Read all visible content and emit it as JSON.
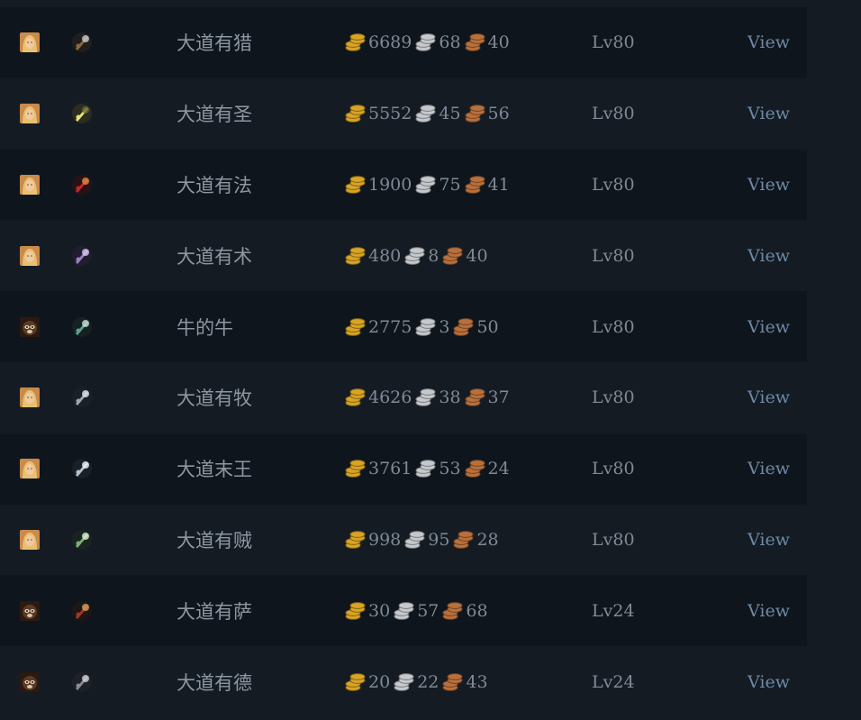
{
  "colors": {
    "gold": "#d8a424",
    "silver": "#c5c8cc",
    "copper": "#b9703c",
    "link": "#6f89a4",
    "text": "#7f8a96",
    "name": "#8d97a2"
  },
  "rows": [
    {
      "race_icon": "human-female-portrait-icon",
      "class_icon": "hunter-icon",
      "name": "大道有猎",
      "gold": "6689",
      "silver": "68",
      "copper": "40",
      "level": "Lv80",
      "action": "View"
    },
    {
      "race_icon": "human-female-portrait-icon",
      "class_icon": "paladin-icon",
      "name": "大道有圣",
      "gold": "5552",
      "silver": "45",
      "copper": "56",
      "level": "Lv80",
      "action": "View"
    },
    {
      "race_icon": "human-female-portrait-icon",
      "class_icon": "mage-icon",
      "name": "大道有法",
      "gold": "1900",
      "silver": "75",
      "copper": "41",
      "level": "Lv80",
      "action": "View"
    },
    {
      "race_icon": "human-female-portrait-icon",
      "class_icon": "warlock-icon",
      "name": "大道有术",
      "gold": "480",
      "silver": "8",
      "copper": "40",
      "level": "Lv80",
      "action": "View"
    },
    {
      "race_icon": "pandaren-portrait-icon",
      "class_icon": "warrior-icon",
      "name": "牛的牛",
      "gold": "2775",
      "silver": "3",
      "copper": "50",
      "level": "Lv80",
      "action": "View"
    },
    {
      "race_icon": "human-female-portrait-icon",
      "class_icon": "priest-icon",
      "name": "大道有牧",
      "gold": "4626",
      "silver": "38",
      "copper": "37",
      "level": "Lv80",
      "action": "View"
    },
    {
      "race_icon": "human-female-portrait-icon",
      "class_icon": "death-knight-icon",
      "name": "大道末王",
      "gold": "3761",
      "silver": "53",
      "copper": "24",
      "level": "Lv80",
      "action": "View"
    },
    {
      "race_icon": "human-female-portrait-icon",
      "class_icon": "rogue-icon",
      "name": "大道有贼",
      "gold": "998",
      "silver": "95",
      "copper": "28",
      "level": "Lv80",
      "action": "View"
    },
    {
      "race_icon": "pandaren-portrait-icon",
      "class_icon": "shaman-icon",
      "name": "大道有萨",
      "gold": "30",
      "silver": "57",
      "copper": "68",
      "level": "Lv24",
      "action": "View"
    },
    {
      "race_icon": "pandaren-portrait-icon",
      "class_icon": "druid-icon",
      "name": "大道有德",
      "gold": "20",
      "silver": "22",
      "copper": "43",
      "level": "Lv24",
      "action": "View"
    }
  ]
}
